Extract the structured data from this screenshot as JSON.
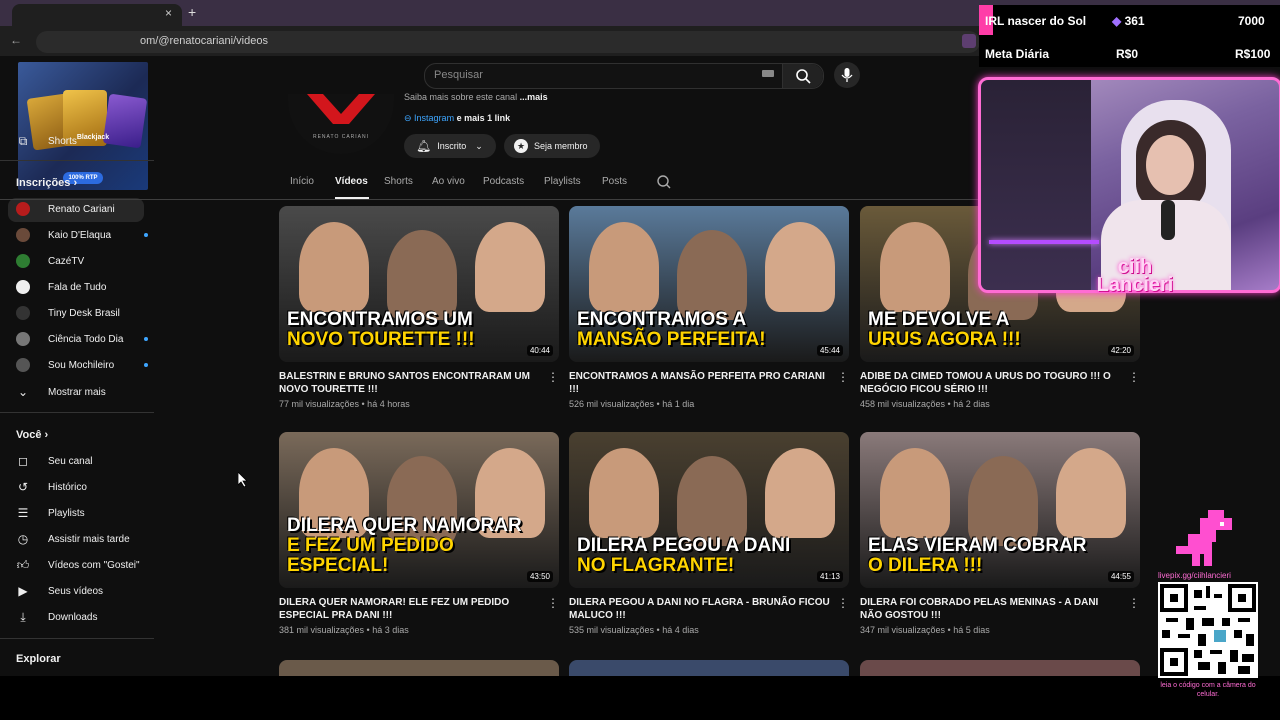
{
  "browser": {
    "url": "om/@renatocariani/videos",
    "new_tab": "+",
    "close": "×"
  },
  "ad": {
    "label": "Blackjack",
    "badge": "100% RTP"
  },
  "search": {
    "placeholder": "Pesquisar"
  },
  "sidebar": {
    "shorts": "Shorts",
    "subs_title": "Inscrições",
    "subs": [
      {
        "label": "Renato Cariani",
        "dot": false
      },
      {
        "label": "Kaio D'Elaqua",
        "dot": true
      },
      {
        "label": "CazéTV",
        "dot": false
      },
      {
        "label": "Fala de Tudo",
        "dot": false
      },
      {
        "label": "Tiny Desk Brasil",
        "dot": false
      },
      {
        "label": "Ciência Todo Dia",
        "dot": true
      },
      {
        "label": "Sou Mochileiro",
        "dot": true
      }
    ],
    "more": "Mostrar mais",
    "you_title": "Você",
    "you": [
      {
        "label": "Seu canal",
        "icon": "user-icon"
      },
      {
        "label": "Histórico",
        "icon": "history-icon"
      },
      {
        "label": "Playlists",
        "icon": "playlist-icon"
      },
      {
        "label": "Assistir mais tarde",
        "icon": "clock-icon"
      },
      {
        "label": "Vídeos com \"Gostei\"",
        "icon": "like-icon"
      },
      {
        "label": "Seus vídeos",
        "icon": "video-icon"
      },
      {
        "label": "Downloads",
        "icon": "download-icon"
      }
    ],
    "explore": "Explorar"
  },
  "channel": {
    "logo_text": "RENATO CARIANI",
    "about": "Saiba mais sobre este canal",
    "about_more": "...mais",
    "link": "Instagram",
    "link_more": "e mais 1 link",
    "subscribed": "Inscrito",
    "join": "Seja membro",
    "tabs": [
      "Início",
      "Vídeos",
      "Shorts",
      "Ao vivo",
      "Podcasts",
      "Playlists",
      "Posts"
    ]
  },
  "videos": [
    {
      "cap1": "ENCONTRAMOS UM",
      "cap2": "NOVO TOURETTE !!!",
      "duration": "40:44",
      "title": "BALESTRIN E BRUNO SANTOS ENCONTRARAM UM NOVO TOURETTE !!!",
      "meta": "77 mil visualizações • há 4 horas",
      "bg": "#4a4a4a"
    },
    {
      "cap1": "ENCONTRAMOS A",
      "cap2": "MANSÃO PERFEITA!",
      "duration": "45:44",
      "title": "ENCONTRAMOS A MANSÃO PERFEITA PRO CARIANI !!!",
      "meta": "526 mil visualizações • há 1 dia",
      "bg": "#5a7a9a"
    },
    {
      "cap1": "ME DEVOLVE A",
      "cap2": "URUS AGORA !!!",
      "duration": "42:20",
      "title": "ADIBE DA CIMED TOMOU A URUS DO TOGURO !!! O NEGÓCIO FICOU SÉRIO !!!",
      "meta": "458 mil visualizações • há 2 dias",
      "bg": "#6a5a3a"
    },
    {
      "cap1": "DILERA QUER NAMORAR",
      "cap2": "E FEZ UM PEDIDO ESPECIAL!",
      "duration": "43:50",
      "title": "DILERA QUER NAMORAR! ELE FEZ UM PEDIDO ESPECIAL PRA DANI !!!",
      "meta": "381 mil visualizações • há 3 dias",
      "bg": "#7a6a5a"
    },
    {
      "cap1": "DILERA PEGOU A DANI",
      "cap2": "NO FLAGRANTE!",
      "duration": "41:13",
      "title": "DILERA PEGOU A DANI NO FLAGRA - BRUNÃO FICOU MALUCO !!!",
      "meta": "535 mil visualizações • há 4 dias",
      "bg": "#4a4030"
    },
    {
      "cap1": "ELAS VIERAM COBRAR",
      "cap2": "O DILERA !!!",
      "duration": "44:55",
      "title": "DILERA FOI COBRADO PELAS MENINAS - A DANI NÃO GOSTOU !!!",
      "meta": "347 mil visualizações • há 5 dias",
      "bg": "#8a7a7a"
    }
  ],
  "overlay": {
    "goal_label": "IRL nascer do Sol",
    "goal_current": "361",
    "goal_target": "7000",
    "daily_label": "Meta Diária",
    "daily_current": "R$0",
    "daily_target": "R$100",
    "streamer": "ciih Lancieri",
    "qr_url": "livepix.gg/ciihlancieri",
    "qr_note": "leia o código com a câmera do celular."
  }
}
